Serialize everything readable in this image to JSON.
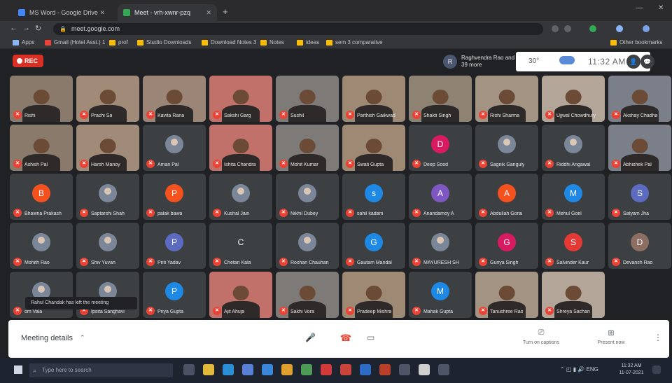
{
  "browser": {
    "tabs": [
      {
        "label": "MS Word - Google Drive",
        "favicon_color": "#4285f4"
      },
      {
        "label": "Meet - vrh-xwnr-pzq",
        "favicon_color": "#34a853"
      }
    ],
    "url": "meet.google.com",
    "bookmarks": [
      {
        "label": "Apps",
        "color": "#8ab4f8"
      },
      {
        "label": "Gmail (Hotel Asst.) 1",
        "color": "#ea4335"
      },
      {
        "label": "prof",
        "color": "#fbbc04"
      },
      {
        "label": "Studio Downloads",
        "color": "#fbbc04"
      },
      {
        "label": "Download Notes 3",
        "color": "#fbbc04"
      },
      {
        "label": "Notes",
        "color": "#fbbc04"
      },
      {
        "label": "ideas",
        "color": "#fbbc04"
      },
      {
        "label": "sem 3 comparative",
        "color": "#fbbc04"
      },
      {
        "label": "Other bookmarks",
        "color": "#fbbc04"
      }
    ]
  },
  "meet": {
    "rec_label": "REC",
    "presenter_initial": "R",
    "presenter_text": "Raghvendra Rao and 39 more",
    "weather_temp": "30°",
    "clock": "11:32 AM",
    "toast": "Rahul Chandak has left the meeting",
    "tiles": [
      {
        "name": "Rishi",
        "type": "camera"
      },
      {
        "name": "Prachi Sa",
        "type": "camera"
      },
      {
        "name": "Kavita Rana",
        "type": "camera"
      },
      {
        "name": "Sakshi Garg",
        "type": "camera"
      },
      {
        "name": "Sushil",
        "type": "camera"
      },
      {
        "name": "Parthish Gaikwad",
        "type": "camera"
      },
      {
        "name": "Shakti Singh",
        "type": "camera"
      },
      {
        "name": "Rishi Sharma",
        "type": "camera"
      },
      {
        "name": "Ujjwal Chowdhury",
        "type": "camera"
      },
      {
        "name": "Akshay Chadha",
        "type": "camera"
      },
      {
        "name": "Ashish Pal",
        "type": "camera"
      },
      {
        "name": "Harsh Manoy",
        "type": "camera"
      },
      {
        "name": "Aman Pal",
        "type": "photo"
      },
      {
        "name": "Ishita Chandra",
        "type": "camera"
      },
      {
        "name": "Mohit Kumar",
        "type": "camera"
      },
      {
        "name": "Swati Gupta",
        "type": "camera"
      },
      {
        "name": "Deep Sood",
        "type": "initial",
        "initial": "D",
        "color": "#d81b60"
      },
      {
        "name": "Sagnik Ganguly",
        "type": "photo"
      },
      {
        "name": "Riddhi Angawal",
        "type": "photo"
      },
      {
        "name": "Abhishek Pal",
        "type": "camera"
      },
      {
        "name": "Bhawna Prakash",
        "type": "initial",
        "initial": "B",
        "color": "#f4511e"
      },
      {
        "name": "Saptarshi Shah",
        "type": "photo"
      },
      {
        "name": "palak bawa",
        "type": "initial",
        "initial": "P",
        "color": "#f4511e"
      },
      {
        "name": "Kushal Jain",
        "type": "photo"
      },
      {
        "name": "Nikhil Dubey",
        "type": "photo"
      },
      {
        "name": "sahil kadam",
        "type": "initial",
        "initial": "s",
        "color": "#1e88e5"
      },
      {
        "name": "Anandamoy A",
        "type": "initial",
        "initial": "A",
        "color": "#7e57c2"
      },
      {
        "name": "Abdullah Gorai",
        "type": "initial",
        "initial": "A",
        "color": "#f4511e"
      },
      {
        "name": "Mehul Goel",
        "type": "initial",
        "initial": "M",
        "color": "#1e88e5"
      },
      {
        "name": "Satyam Jha",
        "type": "initial",
        "initial": "S",
        "color": "#5c6bc0"
      },
      {
        "name": "Mohith Rao",
        "type": "photo"
      },
      {
        "name": "Shiv Yuvan",
        "type": "photo"
      },
      {
        "name": "Priti Yadav",
        "type": "initial",
        "initial": "P",
        "color": "#5c6bc0"
      },
      {
        "name": "Chetan Kala",
        "type": "initial",
        "initial": "C",
        "color": "#3c4043"
      },
      {
        "name": "Roshan Chauhan",
        "type": "photo"
      },
      {
        "name": "Gautam Mandal",
        "type": "initial",
        "initial": "G",
        "color": "#1e88e5"
      },
      {
        "name": "MAYURESH SH",
        "type": "photo"
      },
      {
        "name": "Guriya Singh",
        "type": "initial",
        "initial": "G",
        "color": "#d81b60"
      },
      {
        "name": "Salvinder Kaur",
        "type": "initial",
        "initial": "S",
        "color": "#e53935"
      },
      {
        "name": "Devansh Rao",
        "type": "initial",
        "initial": "D",
        "color": "#8d6e63"
      },
      {
        "name": "om Vala",
        "type": "photo"
      },
      {
        "name": "Ipsita Sanghavi",
        "type": "photo"
      },
      {
        "name": "Priya Gupta",
        "type": "initial",
        "initial": "P",
        "color": "#1e88e5"
      },
      {
        "name": "Ajit Ahuja",
        "type": "camera"
      },
      {
        "name": "Sakhi Vora",
        "type": "camera"
      },
      {
        "name": "Pradeep Mishra",
        "type": "camera"
      },
      {
        "name": "Mahak Gupta",
        "type": "initial",
        "initial": "M",
        "color": "#1e88e5"
      },
      {
        "name": "Tanushree Rao",
        "type": "camera"
      },
      {
        "name": "Shreya Sachan",
        "type": "camera"
      }
    ]
  },
  "controls": {
    "meeting_details": "Meeting details",
    "captions_label": "Turn on captions",
    "present_label": "Present now"
  },
  "taskbar": {
    "search_placeholder": "Type here to search",
    "time": "11:32 AM",
    "date": "11-07-2021",
    "lang": "ENG"
  }
}
